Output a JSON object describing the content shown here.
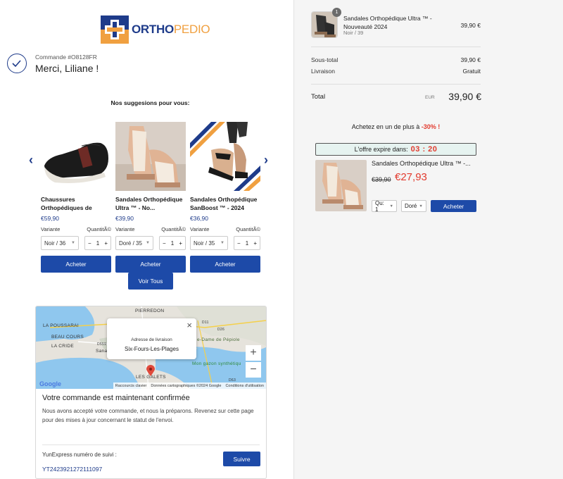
{
  "brand": {
    "part1": "ORTHO",
    "part2": "PEDIO"
  },
  "order": {
    "number": "Commande #O8128FR",
    "thanks": "Merci, Liliane !"
  },
  "suggestions": {
    "title": "Nos suggesions pour vous:",
    "variant_label": "Variante",
    "qty_label": "QuantitÃ©",
    "buy_label": "Acheter",
    "see_all": "Voir Tous",
    "products": [
      {
        "name": "Chaussures Orthopédiques de",
        "price": "€59,90",
        "variant": "Noir / 36",
        "qty": "1"
      },
      {
        "name": "Sandales Orthopédique Ultra ™ - No...",
        "price": "€39,90",
        "variant": "Doré / 35",
        "qty": "1"
      },
      {
        "name": "Sandales Orthopédique SanBoost ™ - 2024",
        "price": "€36,90",
        "variant": "Noir / 35",
        "qty": "1"
      }
    ]
  },
  "map": {
    "labels": [
      "PIERREDON",
      "LA POUSSARAI",
      "BEAU COURS",
      "LA CRIDE",
      "Sana",
      "e-Dame de Pépiole",
      "Mon gazon synthétiqu",
      "LES GALETS",
      "D11",
      "D26",
      "D559",
      "D63"
    ],
    "popup_title": "Adresse de livraison",
    "popup_city": "Six-Fours-Les-Plages",
    "zoom_in": "+",
    "zoom_out": "−",
    "google": "Google",
    "footer": [
      "Raccourcis clavier",
      "Données cartographiques ©2024 Google",
      "Conditions d'utilisation"
    ]
  },
  "confirmation": {
    "title": "Votre commande est maintenant confirmée",
    "text": "Nous avons accepté votre commande, et nous la préparons. Revenez sur cette page pour des mises à jour concernant le statut de l'envoi.",
    "tracking_label": "YunExpress numéro de suivi :",
    "tracking_number": "YT2423921272111097",
    "follow_button": "Suivre"
  },
  "cart": {
    "badge": "1",
    "item_name": "Sandales Orthopédique Ultra ™ - Nouveauté 2024",
    "item_variant": "Noir / 39",
    "item_price": "39,90 €",
    "subtotal_label": "Sous-total",
    "subtotal": "39,90 €",
    "shipping_label": "Livraison",
    "shipping": "Gratuit",
    "total_label": "Total",
    "currency": "EUR",
    "total": "39,90 €"
  },
  "upsell": {
    "headline": "Achetez en un de plus à",
    "discount": "-30% !",
    "timer_label": "L'offre expire dans:",
    "timer": "03 : 20",
    "name": "Sandales Orthopédique Ultra ™ -...",
    "old_price": "€39,90",
    "new_price": "€27,93",
    "qty": "Qu: 1",
    "variant": "Doré",
    "button": "Acheter"
  },
  "colors": {
    "accent": "#1d4aa8",
    "brand_blue": "#1e3b8a",
    "brand_orange": "#f0a040",
    "sale_red": "#e23a2e"
  }
}
